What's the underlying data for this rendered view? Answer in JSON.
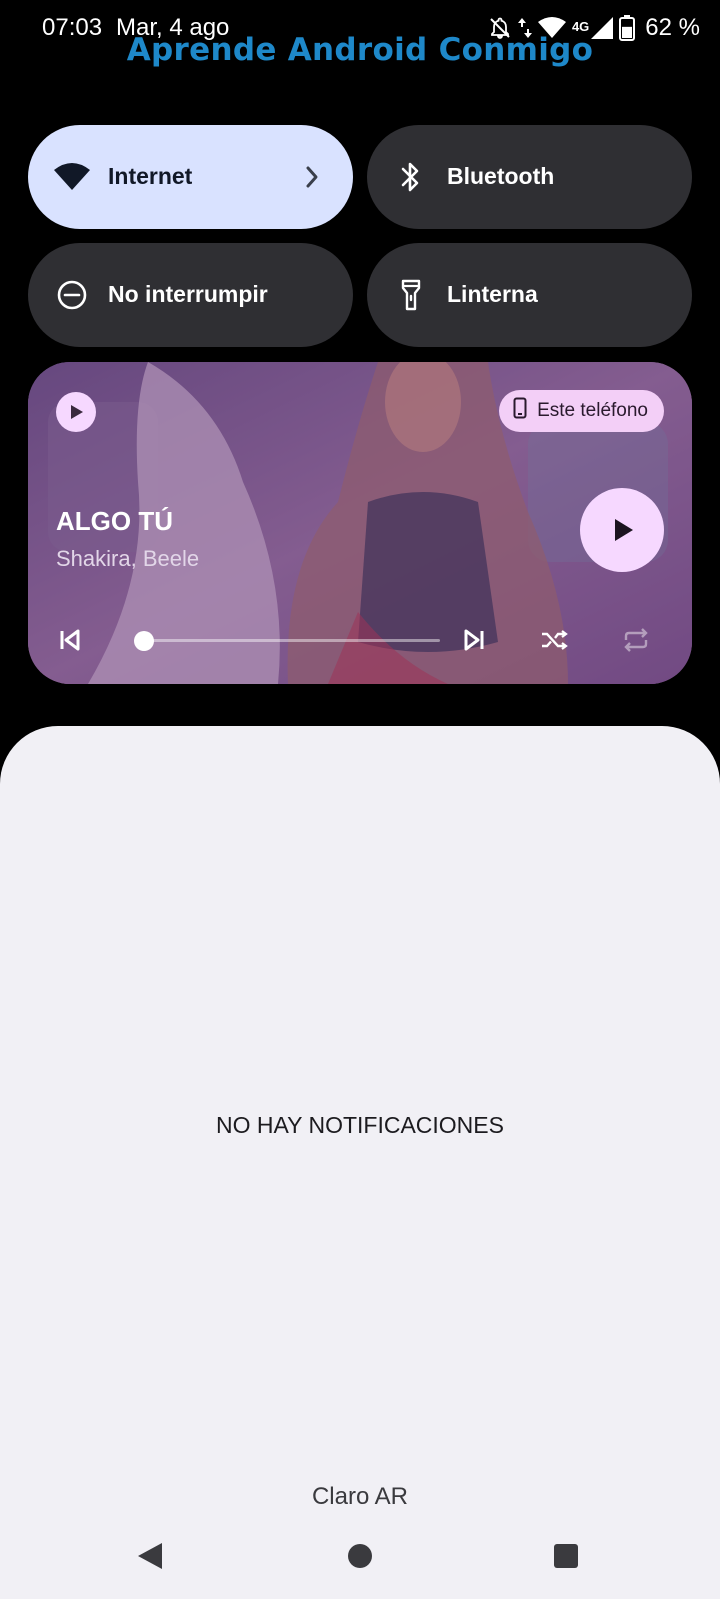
{
  "status_bar": {
    "time": "07:03",
    "date": "Mar, 4 ago",
    "network_type": "4G",
    "battery_percent": "62 %",
    "battery_level": 0.62,
    "icons": [
      "notifications-off-icon",
      "data-arrows-icon",
      "wifi-icon",
      "cell-signal-icon",
      "battery-icon"
    ]
  },
  "watermark": "Aprende Android Conmigo",
  "quick_settings": {
    "tiles": [
      {
        "label": "Internet",
        "icon": "wifi-icon",
        "active": true
      },
      {
        "label": "Bluetooth",
        "icon": "bluetooth-icon",
        "active": false
      },
      {
        "label": "No interrumpir",
        "icon": "do-not-disturb-icon",
        "active": false
      },
      {
        "label": "Linterna",
        "icon": "flashlight-icon",
        "active": false
      }
    ]
  },
  "media": {
    "title": "ALGO TÚ",
    "artist": "Shakira, Beele",
    "output_device": "Este teléfono",
    "progress": 0.02
  },
  "shade": {
    "empty_message": "NO HAY NOTIFICACIONES",
    "carrier": "Claro AR"
  },
  "colors": {
    "tile_active": "#d9e2ff",
    "tile_inactive": "#2f2f33",
    "media_accent": "#f6d8ff",
    "shade_bg": "#f1f0f5",
    "watermark": "#1e88c9"
  }
}
